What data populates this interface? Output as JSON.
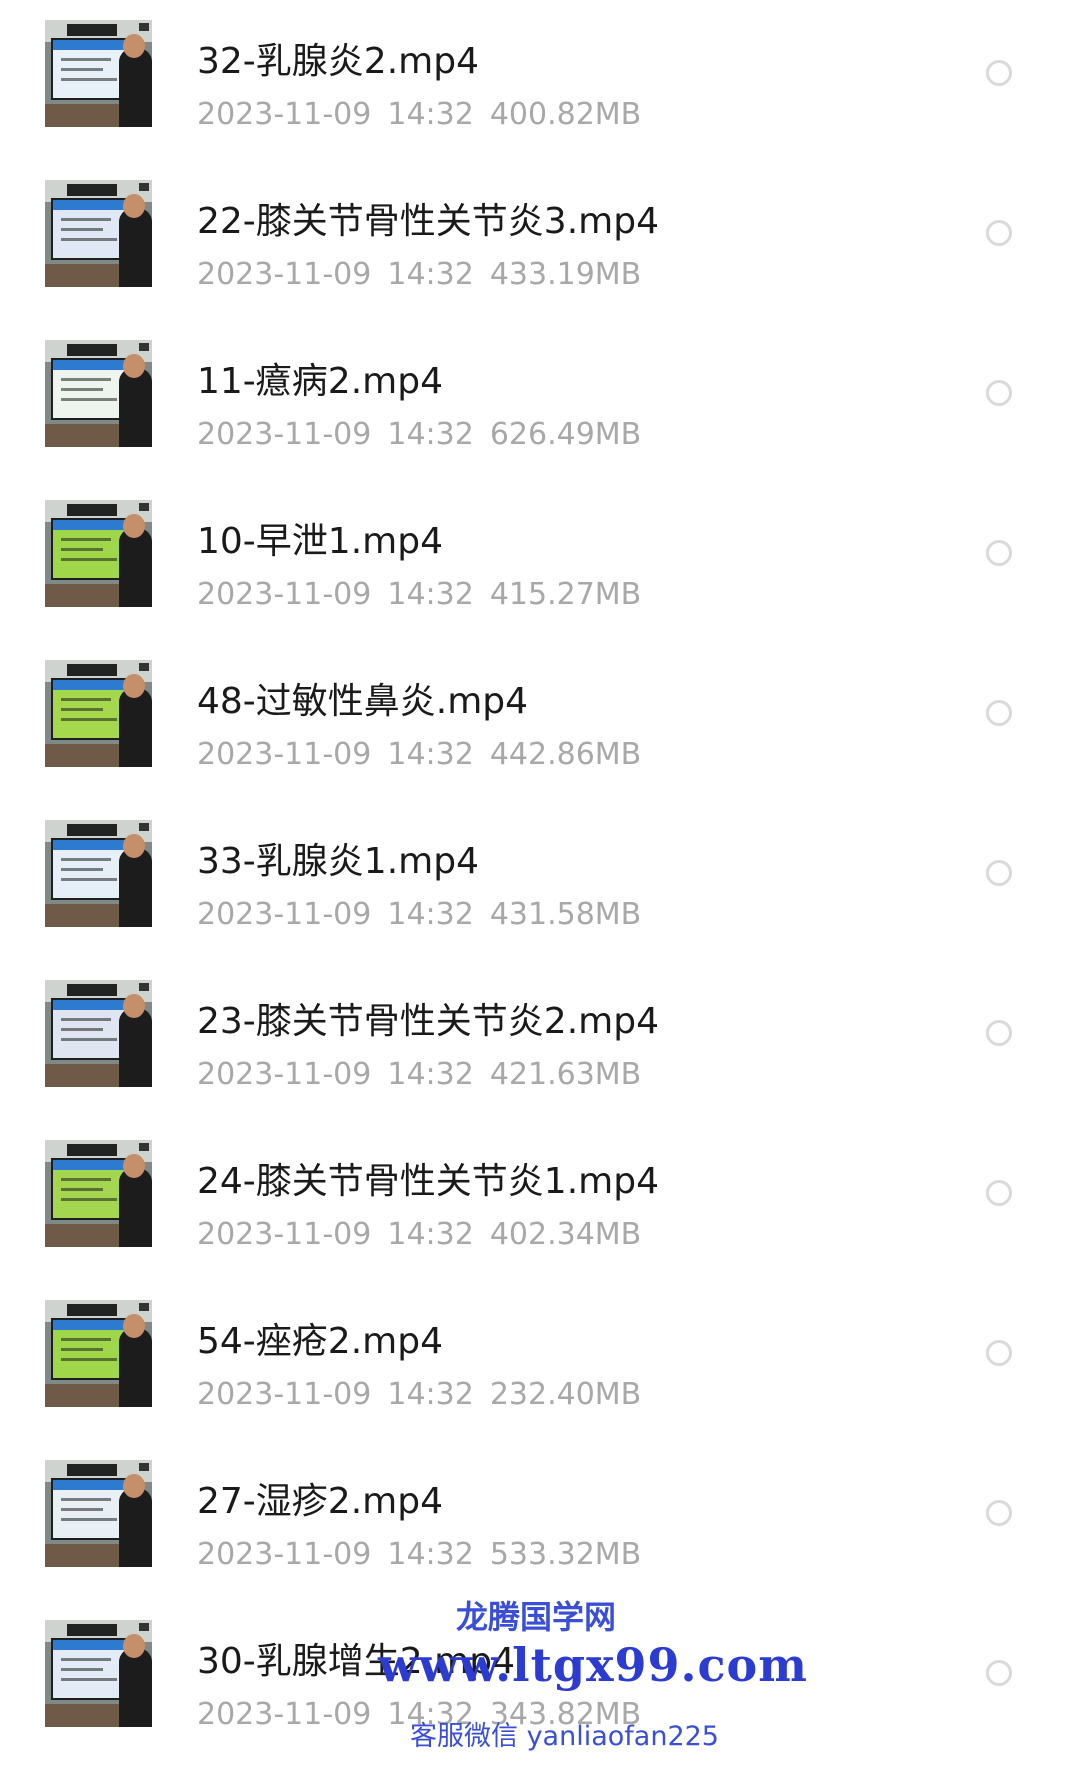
{
  "files": [
    {
      "name": "32-乳腺炎2.mp4",
      "date": "2023-11-09",
      "time": "14:32",
      "size": "400.82MB",
      "screen_color": "#e9f1f8"
    },
    {
      "name": "22-膝关节骨性关节炎3.mp4",
      "date": "2023-11-09",
      "time": "14:32",
      "size": "433.19MB",
      "screen_color": "#dfe8f4"
    },
    {
      "name": "11-癔病2.mp4",
      "date": "2023-11-09",
      "time": "14:32",
      "size": "626.49MB",
      "screen_color": "#eef5ee"
    },
    {
      "name": "10-早泄1.mp4",
      "date": "2023-11-09",
      "time": "14:32",
      "size": "415.27MB",
      "screen_color": "#9fd64a"
    },
    {
      "name": "48-过敏性鼻炎.mp4",
      "date": "2023-11-09",
      "time": "14:32",
      "size": "442.86MB",
      "screen_color": "#a6d84e"
    },
    {
      "name": "33-乳腺炎1.mp4",
      "date": "2023-11-09",
      "time": "14:32",
      "size": "431.58MB",
      "screen_color": "#e6eef8"
    },
    {
      "name": "23-膝关节骨性关节炎2.mp4",
      "date": "2023-11-09",
      "time": "14:32",
      "size": "421.63MB",
      "screen_color": "#dfe6f2"
    },
    {
      "name": "24-膝关节骨性关节炎1.mp4",
      "date": "2023-11-09",
      "time": "14:32",
      "size": "402.34MB",
      "screen_color": "#a5d650"
    },
    {
      "name": "54-痤疮2.mp4",
      "date": "2023-11-09",
      "time": "14:32",
      "size": "232.40MB",
      "screen_color": "#9fd64a"
    },
    {
      "name": "27-湿疹2.mp4",
      "date": "2023-11-09",
      "time": "14:32",
      "size": "533.32MB",
      "screen_color": "#e8f0f6"
    },
    {
      "name": "30-乳腺增生2.mp4",
      "date": "2023-11-09",
      "time": "14:32",
      "size": "343.82MB",
      "screen_color": "#e3ecf6"
    }
  ],
  "watermark": {
    "line1": "龙腾国学网",
    "line2": "www.ltgx99.com",
    "line3": "客服微信 yanliaofan225"
  }
}
